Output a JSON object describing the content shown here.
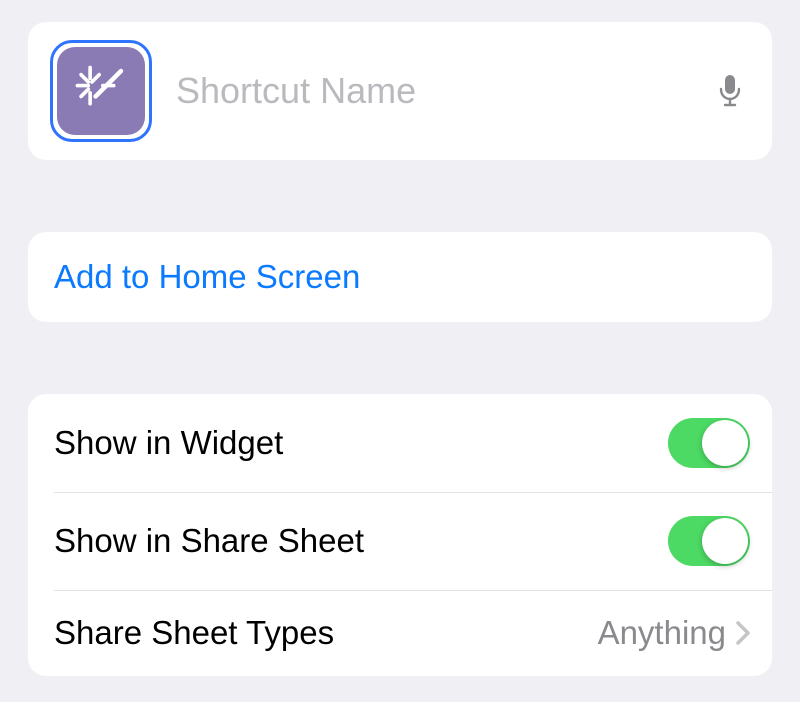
{
  "header": {
    "name_value": "",
    "name_placeholder": "Shortcut Name",
    "icon_name": "magic-wand-sparkle-icon"
  },
  "actions": {
    "add_to_home_label": "Add to Home Screen"
  },
  "settings": {
    "rows": [
      {
        "label": "Show in Widget",
        "type": "toggle",
        "value": true
      },
      {
        "label": "Show in Share Sheet",
        "type": "toggle",
        "value": true
      },
      {
        "label": "Share Sheet Types",
        "type": "nav",
        "value": "Anything"
      }
    ]
  },
  "colors": {
    "accent": "#0a7aff",
    "toggle_on": "#4cd964",
    "shortcut_icon_bg": "#8a7bb5",
    "selection_ring": "#2f74ff"
  }
}
